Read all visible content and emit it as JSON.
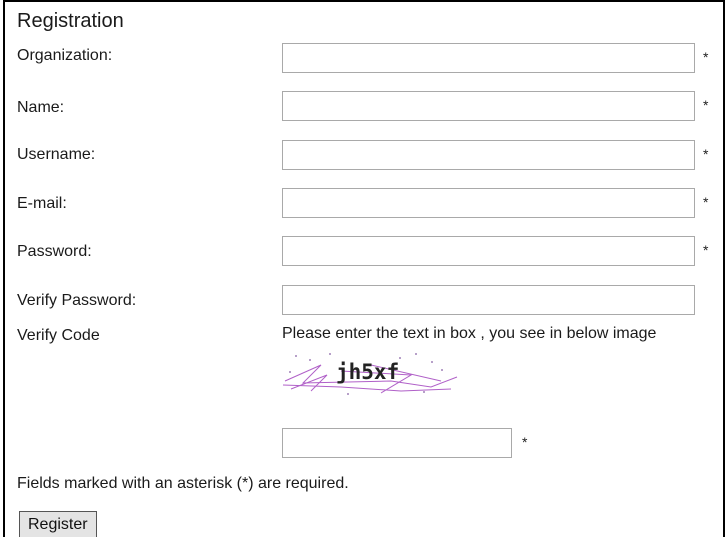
{
  "form": {
    "title": "Registration",
    "required_mark": "*",
    "fields": [
      {
        "label": "Organization:",
        "value": ""
      },
      {
        "label": "Name:",
        "value": ""
      },
      {
        "label": "Username:",
        "value": ""
      },
      {
        "label": "E-mail:",
        "value": ""
      },
      {
        "label": "Password:",
        "value": ""
      },
      {
        "label": "Verify Password:",
        "value": ""
      }
    ],
    "verify_code": {
      "label": "Verify Code",
      "hint": "Please enter the text in box , you see in below image",
      "captcha_text": "jh5xf",
      "value": ""
    },
    "footnote": "Fields marked with an asterisk (*) are required.",
    "submit_label": "Register"
  }
}
